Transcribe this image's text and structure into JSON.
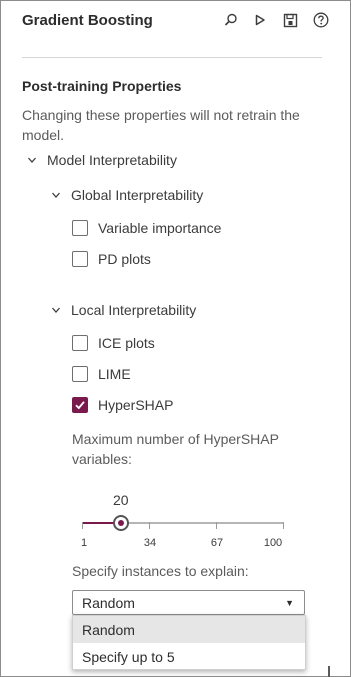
{
  "panel": {
    "title": "Gradient Boosting",
    "icons": [
      "search-icon",
      "run-icon",
      "save-icon",
      "help-icon"
    ]
  },
  "post_training": {
    "heading": "Post-training Properties",
    "description": "Changing these properties will not retrain the model.",
    "model_interpretability": {
      "label": "Model Interpretability",
      "global": {
        "label": "Global Interpretability",
        "options": [
          {
            "label": "Variable importance",
            "checked": false
          },
          {
            "label": "PD plots",
            "checked": false
          }
        ]
      },
      "local": {
        "label": "Local Interpretability",
        "options": [
          {
            "label": "ICE plots",
            "checked": false
          },
          {
            "label": "LIME",
            "checked": false
          },
          {
            "label": "HyperSHAP",
            "checked": true
          }
        ]
      }
    },
    "hypershap": {
      "max_vars_label": "Maximum number of HyperSHAP variables:",
      "slider": {
        "value": "20",
        "min": 1,
        "max": 100,
        "ticks": [
          "1",
          "34",
          "67",
          "100"
        ]
      },
      "instances_label": "Specify instances to explain:",
      "instances_select": {
        "value": "Random",
        "options": [
          "Random",
          "Specify up to 5"
        ]
      }
    }
  },
  "colors": {
    "accent": "#7a1a4c",
    "text": "#3b3b3b",
    "muted": "#5b5b5b"
  }
}
